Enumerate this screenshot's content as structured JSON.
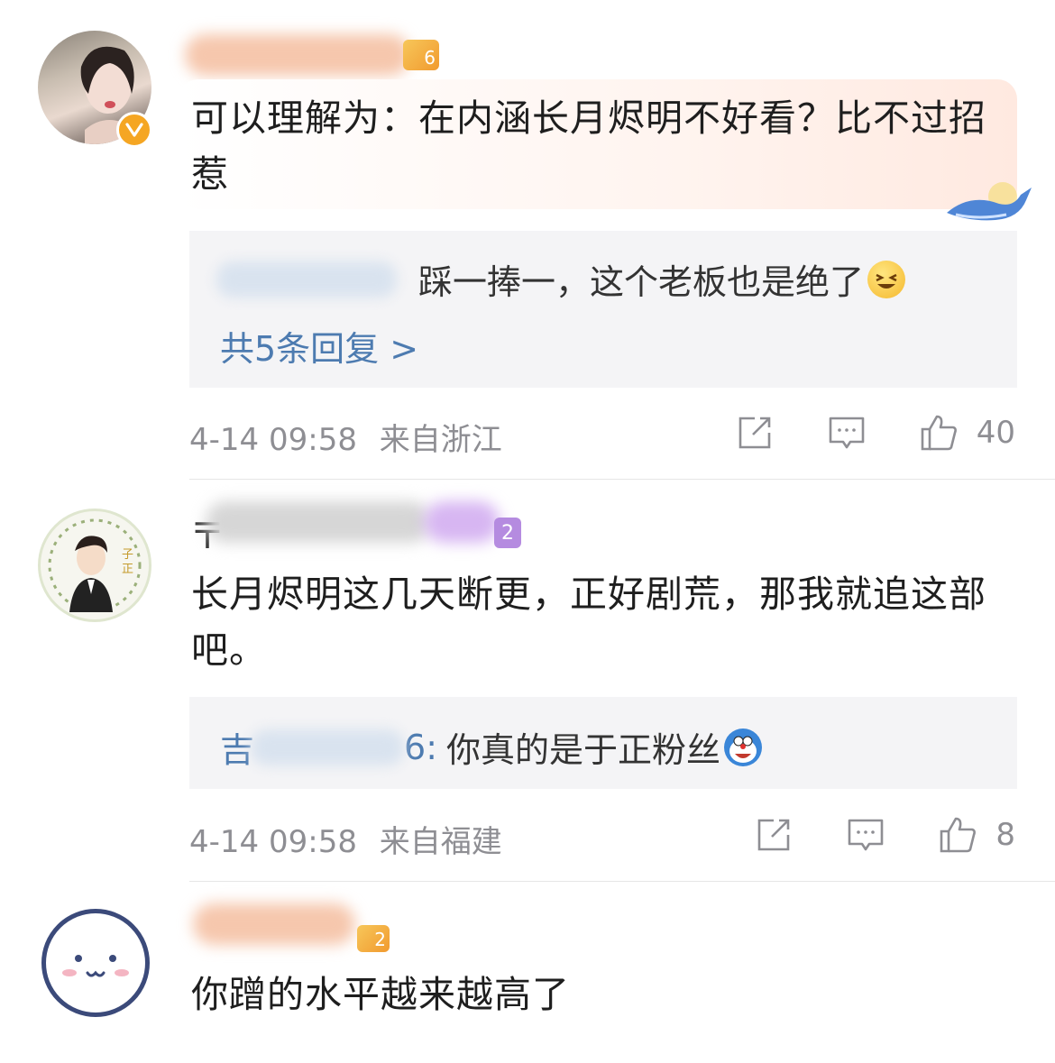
{
  "comments": [
    {
      "badge_level": "6",
      "text": "可以理解为：在内涵长月烬明不好看？比不过招惹",
      "reply": {
        "text": "踩一捧一，这个老板也是绝了",
        "emoji": "grinning-squint-emoji"
      },
      "more_replies": "共5条回复 >",
      "time": "4-14 09:58",
      "location": "来自浙江",
      "likes": "40"
    },
    {
      "badge_level": "2",
      "text": "长月烬明这几天断更，正好剧荒，那我就追这部吧。",
      "reply": {
        "name_suffix": "6:",
        "text": "你真的是于正粉丝",
        "emoji": "doraemon-emoji"
      },
      "time": "4-14 09:58",
      "location": "来自福建",
      "likes": "8"
    },
    {
      "badge_level": "2",
      "text": "你蹭的水平越来越高了"
    }
  ],
  "colors": {
    "link": "#4d7bb0",
    "meta": "#8e8e93",
    "reply_bg": "#f4f4f6",
    "verified": "#f5a623"
  }
}
